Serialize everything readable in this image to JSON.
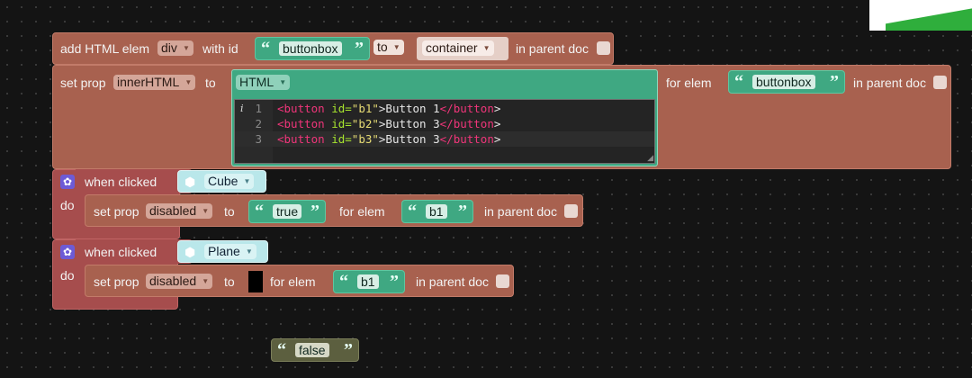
{
  "block1": {
    "label_add": "add HTML elem",
    "elem_type": "div",
    "label_with_id": "with id",
    "id_value": "buttonbox",
    "to_option": "to",
    "target_value": "container",
    "label_in_parent": "in parent doc"
  },
  "block2": {
    "label_set_prop": "set prop",
    "prop": "innerHTML",
    "label_to": "to",
    "lang": "HTML",
    "label_for_elem": "for elem",
    "elem_value": "buttonbox",
    "label_in_parent": "in parent doc",
    "info_marker": "i",
    "code_lines": [
      {
        "num": "1",
        "open": "<button",
        "attr": " id=",
        "val": "\"b1\"",
        "text": ">Button 1",
        "close": "</button",
        "end": ">"
      },
      {
        "num": "2",
        "open": "<button",
        "attr": " id=",
        "val": "\"b2\"",
        "text": ">Button 3",
        "close": "</button",
        "end": ">"
      },
      {
        "num": "3",
        "open": "<button",
        "attr": " id=",
        "val": "\"b3\"",
        "text": ">Button 3",
        "close": "</button",
        "end": ">"
      }
    ]
  },
  "event1": {
    "label_when_clicked": "when clicked",
    "object": "Cube",
    "label_do": "do",
    "label_set_prop": "set prop",
    "prop": "disabled",
    "label_to": "to",
    "value": "true",
    "label_for_elem": "for elem",
    "elem_value": "b1",
    "label_in_parent": "in parent doc"
  },
  "event2": {
    "label_when_clicked": "when clicked",
    "object": "Plane",
    "label_do": "do",
    "label_set_prop": "set prop",
    "prop": "disabled",
    "label_to": "to",
    "label_for_elem": "for elem",
    "elem_value": "b1",
    "label_in_parent": "in parent doc"
  },
  "loose_block": {
    "value": "false"
  },
  "colors": {
    "workspace": "#141414",
    "brown_block": "#a8614f",
    "event_block": "#a64d4d",
    "text_block": "#3fa882",
    "object_block": "#b9e7ea",
    "accent_green": "#2fae3c"
  }
}
